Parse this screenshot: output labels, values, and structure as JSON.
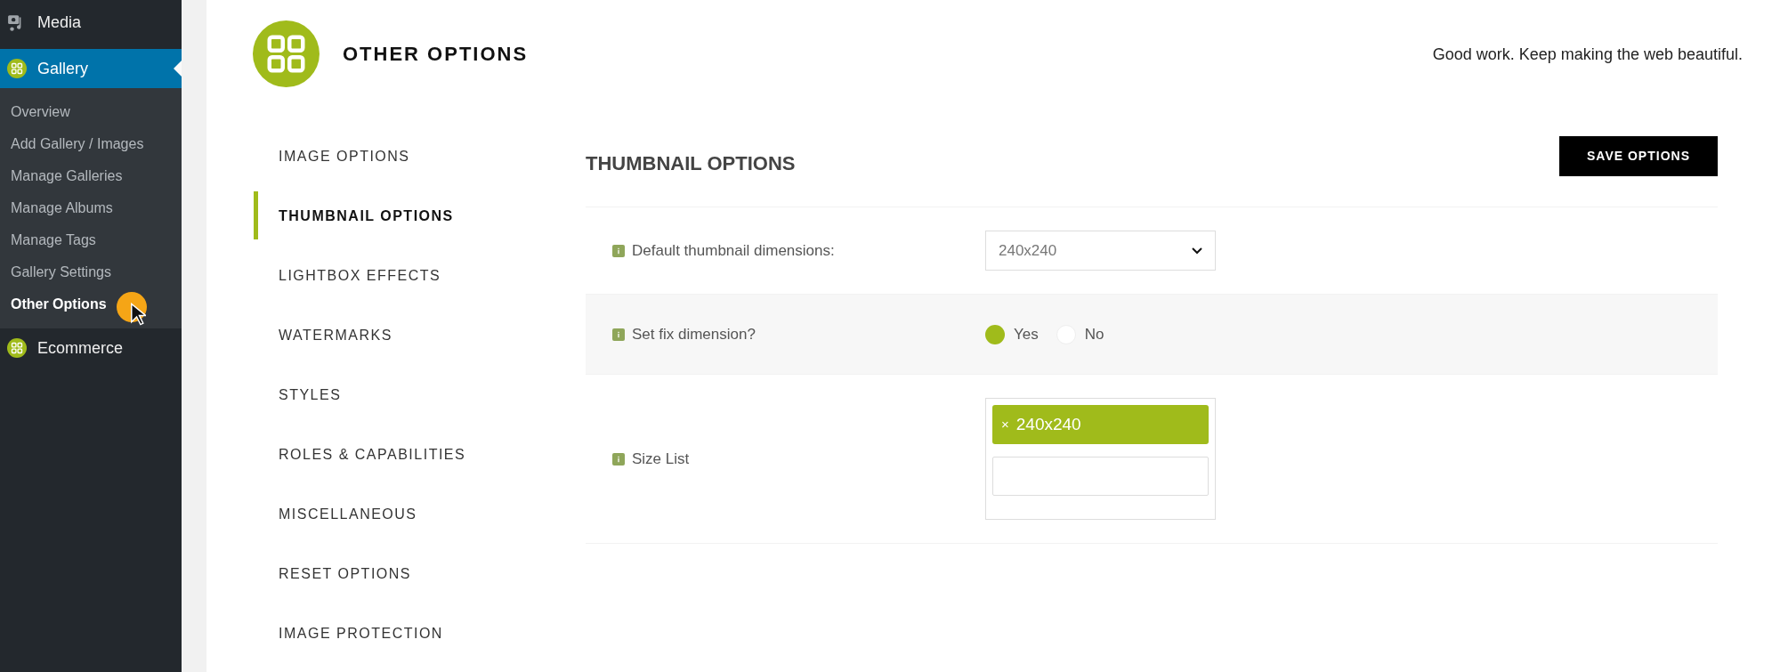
{
  "admin_menu": {
    "items": [
      {
        "label": "Media",
        "kind": "media",
        "selected": false
      },
      {
        "label": "Gallery",
        "kind": "gallery",
        "selected": true,
        "children": [
          {
            "label": "Overview",
            "selected": false
          },
          {
            "label": "Add Gallery / Images",
            "selected": false
          },
          {
            "label": "Manage Galleries",
            "selected": false
          },
          {
            "label": "Manage Albums",
            "selected": false
          },
          {
            "label": "Manage Tags",
            "selected": false
          },
          {
            "label": "Gallery Settings",
            "selected": false
          },
          {
            "label": "Other Options",
            "selected": true
          }
        ]
      },
      {
        "label": "Ecommerce",
        "kind": "gallery",
        "selected": false
      }
    ]
  },
  "header": {
    "title": "OTHER OPTIONS",
    "tagline": "Good work. Keep making the web beautiful."
  },
  "options_nav": [
    {
      "label": "IMAGE OPTIONS",
      "selected": false
    },
    {
      "label": "THUMBNAIL OPTIONS",
      "selected": true
    },
    {
      "label": "LIGHTBOX EFFECTS",
      "selected": false
    },
    {
      "label": "WATERMARKS",
      "selected": false
    },
    {
      "label": "STYLES",
      "selected": false
    },
    {
      "label": "ROLES & CAPABILITIES",
      "selected": false
    },
    {
      "label": "MISCELLANEOUS",
      "selected": false
    },
    {
      "label": "RESET OPTIONS",
      "selected": false
    },
    {
      "label": "IMAGE PROTECTION",
      "selected": false
    }
  ],
  "section": {
    "title": "THUMBNAIL OPTIONS",
    "save_button": "SAVE OPTIONS",
    "rows": [
      {
        "kind": "select",
        "label": "Default thumbnail dimensions:",
        "value": "240x240"
      },
      {
        "kind": "radio",
        "label": "Set fix dimension?",
        "options": [
          {
            "label": "Yes",
            "selected": true
          },
          {
            "label": "No",
            "selected": false
          }
        ]
      },
      {
        "kind": "tags",
        "label": "Size List",
        "tags": [
          {
            "remove": "×",
            "label": "240x240"
          }
        ]
      }
    ]
  }
}
